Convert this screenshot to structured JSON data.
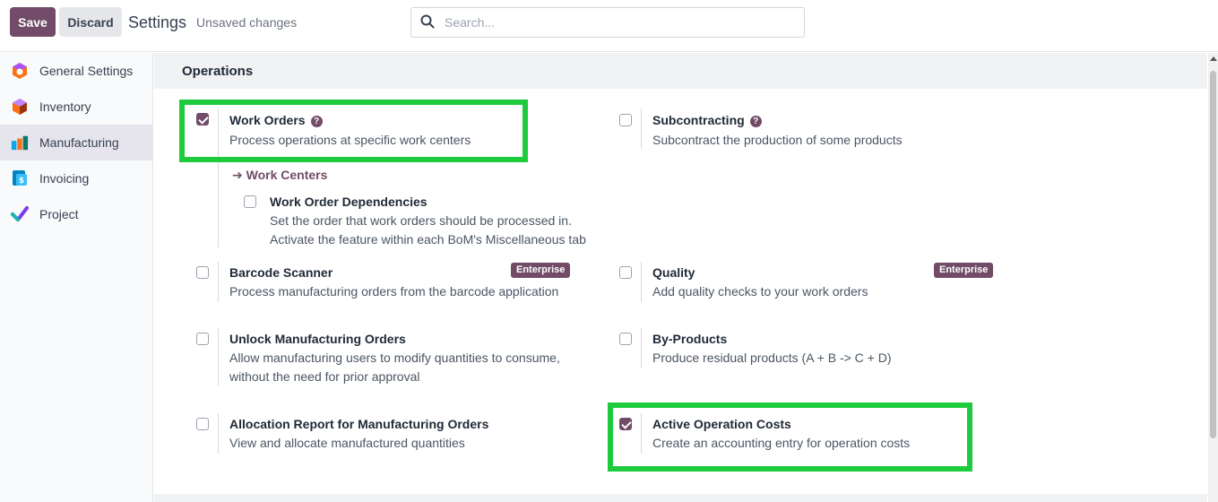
{
  "topbar": {
    "save_label": "Save",
    "discard_label": "Discard",
    "title": "Settings",
    "status": "Unsaved changes",
    "search_placeholder": "Search..."
  },
  "sidebar": {
    "items": [
      {
        "label": "General Settings",
        "icon": "general-settings-icon",
        "active": false
      },
      {
        "label": "Inventory",
        "icon": "inventory-icon",
        "active": false
      },
      {
        "label": "Manufacturing",
        "icon": "manufacturing-icon",
        "active": true
      },
      {
        "label": "Invoicing",
        "icon": "invoicing-icon",
        "active": false
      },
      {
        "label": "Project",
        "icon": "project-icon",
        "active": false
      }
    ]
  },
  "section": {
    "title": "Operations"
  },
  "settings": {
    "work_orders": {
      "title": "Work Orders",
      "desc": "Process operations at specific work centers",
      "checked": true,
      "help": "?"
    },
    "work_centers_link": "Work Centers",
    "work_order_dependencies": {
      "title": "Work Order Dependencies",
      "desc1": "Set the order that work orders should be processed in.",
      "desc2": "Activate the feature within each BoM's Miscellaneous tab",
      "checked": false
    },
    "subcontracting": {
      "title": "Subcontracting",
      "desc": "Subcontract the production of some products",
      "checked": false,
      "help": "?"
    },
    "barcode_scanner": {
      "title": "Barcode Scanner",
      "desc": "Process manufacturing orders from the barcode application",
      "checked": false,
      "badge": "Enterprise"
    },
    "quality": {
      "title": "Quality",
      "desc": "Add quality checks to your work orders",
      "checked": false,
      "badge": "Enterprise"
    },
    "unlock_mo": {
      "title": "Unlock Manufacturing Orders",
      "desc1": "Allow manufacturing users to modify quantities to consume,",
      "desc2": "without the need for prior approval",
      "checked": false
    },
    "by_products": {
      "title": "By-Products",
      "desc": "Produce residual products (A + B -> C + D)",
      "checked": false
    },
    "allocation_report": {
      "title": "Allocation Report for Manufacturing Orders",
      "desc": "View and allocate manufactured quantities",
      "checked": false
    },
    "operation_costs": {
      "title": "Active Operation Costs",
      "desc": "Create an accounting entry for operation costs",
      "checked": true
    }
  },
  "colors": {
    "brand": "#714b67",
    "highlight": "#1ecb3d"
  }
}
